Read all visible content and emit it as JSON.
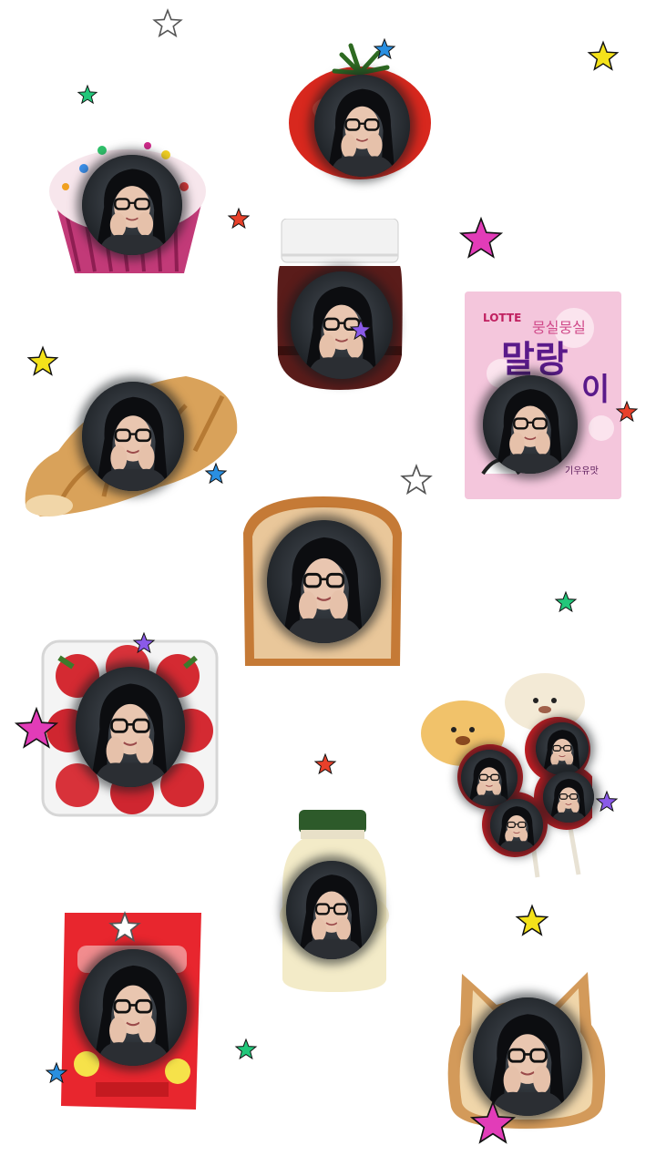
{
  "image": {
    "subject": "collage of food items each framed around a circular portrait, scattered with colored stars",
    "background_color": "#ffffff"
  },
  "items": [
    {
      "name": "cupcake",
      "label": ""
    },
    {
      "name": "tomato",
      "label": ""
    },
    {
      "name": "chocolate-spread-jar",
      "label": ""
    },
    {
      "name": "marshmallow-bag",
      "brand": "LOTTE",
      "title_line1": "말랑",
      "title_line2": "이",
      "top_text": "뭉실뭉실",
      "bottom_text": "기우유맛"
    },
    {
      "name": "croissant",
      "label": ""
    },
    {
      "name": "toast-slice",
      "label": ""
    },
    {
      "name": "strawberry-box",
      "label": ""
    },
    {
      "name": "puppy-candy-skewer",
      "label": ""
    },
    {
      "name": "banana-milk-bottle",
      "label": ""
    },
    {
      "name": "gummy-bag",
      "label": ""
    },
    {
      "name": "cat-shaped-toast",
      "label": ""
    }
  ],
  "star_colors": {
    "white": "#ffffff",
    "green": "#22c77a",
    "blue": "#2a8fe0",
    "yellow": "#f4e21a",
    "red": "#e8402a",
    "magenta": "#e23cb8",
    "purple": "#8a5ae8"
  }
}
